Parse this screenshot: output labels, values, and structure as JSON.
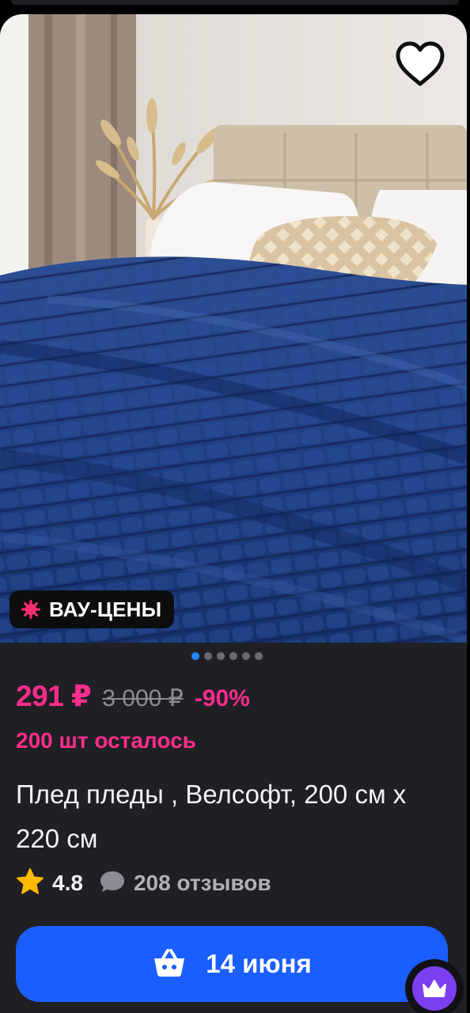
{
  "product": {
    "title": " Плед пледы , Велсофт, 200 см х 220 см",
    "promo_badge": "ВАУ-ЦЕНЫ",
    "price_current": "291 ₽",
    "price_old": "3 000 ₽",
    "discount": "-90%",
    "stock_left": "200 шт осталось",
    "rating": "4.8",
    "reviews": "208 отзывов",
    "image_count": 6,
    "active_image": 1,
    "favorite": false
  },
  "cart": {
    "label": "14 июня"
  },
  "icons": {
    "favorite": "heart-icon",
    "promo": "sparkle-icon",
    "rating": "star-icon",
    "reviews": "chat-bubble-icon",
    "cart": "basket-icon",
    "premium": "crown-icon"
  },
  "colors": {
    "accent_pink": "#ff2d8c",
    "button_blue": "#1a5eff",
    "star_yellow": "#ffb800",
    "card_background": "#1f1f24",
    "active_dot": "#1e88ff",
    "crown_purple": "#7b3ff0"
  }
}
